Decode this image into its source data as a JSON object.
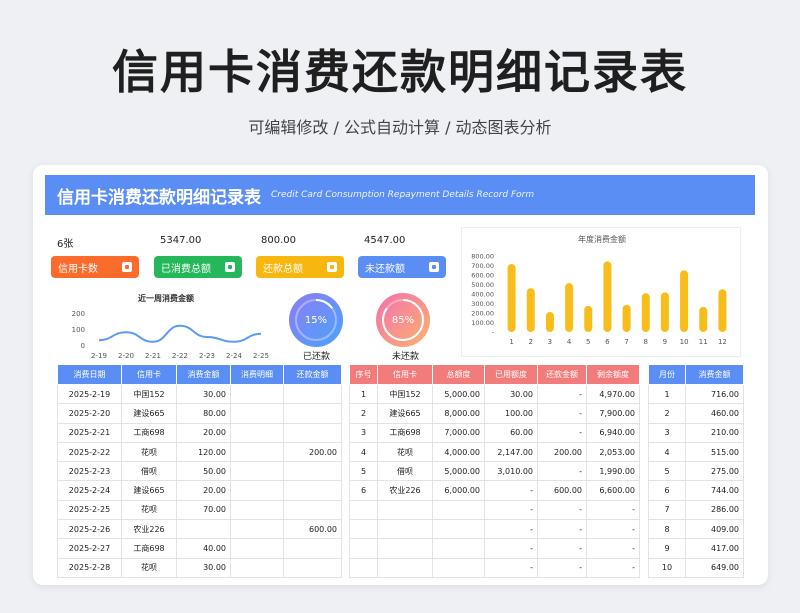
{
  "title": "信用卡消费还款明细记录表",
  "subtitle": "可编辑修改 /  公式自动计算  /  动态图表分析",
  "banner": {
    "cn": "信用卡消费还款明细记录表",
    "en": "Credit Card Consumption Repayment Details Record Form"
  },
  "kpis": [
    {
      "value": "6张",
      "label": "信用卡数",
      "color": "#fb6b2c"
    },
    {
      "value": "5347.00",
      "label": "已消费总额",
      "color": "#25b85a"
    },
    {
      "value": "800.00",
      "label": "还款总额",
      "color": "#f8b70e"
    },
    {
      "value": "4547.00",
      "label": "未还款额",
      "color": "#5b8ef5"
    }
  ],
  "rings": [
    {
      "pct": "15%",
      "caption": "已还款",
      "fraction": 0.15
    },
    {
      "pct": "85%",
      "caption": "未还款",
      "fraction": 0.85
    }
  ],
  "weekly_title": "近一周消费金额",
  "yearly_title": "年度消费金额",
  "chart_data": [
    {
      "type": "line",
      "title": "近一周消费金额",
      "categories": [
        "2-19",
        "2-20",
        "2-21",
        "2-22",
        "2-23",
        "2-24",
        "2-25"
      ],
      "values": [
        30,
        80,
        20,
        120,
        50,
        20,
        70
      ],
      "ylim": [
        0,
        200
      ],
      "yticks": [
        "200",
        "100",
        "0"
      ]
    },
    {
      "type": "bar",
      "title": "年度消费金额",
      "categories": [
        "1",
        "2",
        "3",
        "4",
        "5",
        "6",
        "7",
        "8",
        "9",
        "10",
        "11",
        "12"
      ],
      "values": [
        716,
        460,
        210,
        515,
        275,
        744,
        286,
        409,
        417,
        649,
        265,
        450
      ],
      "ylim": [
        0,
        800
      ],
      "yticks": [
        "800.00",
        "700.00",
        "600.00",
        "500.00",
        "400.00",
        "300.00",
        "200.00",
        "100.00",
        "-"
      ]
    }
  ],
  "consume_table": {
    "headers": [
      "消费日期",
      "信用卡",
      "消费金额",
      "消费明细",
      "还款金额"
    ],
    "rows": [
      [
        "2025-2-19",
        "中国152",
        "30.00",
        "",
        ""
      ],
      [
        "2025-2-20",
        "建设665",
        "80.00",
        "",
        ""
      ],
      [
        "2025-2-21",
        "工商698",
        "20.00",
        "",
        ""
      ],
      [
        "2025-2-22",
        "花呗",
        "120.00",
        "",
        "200.00"
      ],
      [
        "2025-2-23",
        "借呗",
        "50.00",
        "",
        ""
      ],
      [
        "2025-2-24",
        "建设665",
        "20.00",
        "",
        ""
      ],
      [
        "2025-2-25",
        "花呗",
        "70.00",
        "",
        ""
      ],
      [
        "2025-2-26",
        "农业226",
        "",
        "",
        "600.00"
      ],
      [
        "2025-2-27",
        "工商698",
        "40.00",
        "",
        ""
      ],
      [
        "2025-2-28",
        "花呗",
        "30.00",
        "",
        ""
      ]
    ]
  },
  "card_table": {
    "headers": [
      "序号",
      "信用卡",
      "总额度",
      "已用额度",
      "还款金额",
      "剩余额度"
    ],
    "rows": [
      [
        "1",
        "中国152",
        "5,000.00",
        "30.00",
        "-",
        "4,970.00"
      ],
      [
        "2",
        "建设665",
        "8,000.00",
        "100.00",
        "-",
        "7,900.00"
      ],
      [
        "3",
        "工商698",
        "7,000.00",
        "60.00",
        "-",
        "6,940.00"
      ],
      [
        "4",
        "花呗",
        "4,000.00",
        "2,147.00",
        "200.00",
        "2,053.00"
      ],
      [
        "5",
        "借呗",
        "5,000.00",
        "3,010.00",
        "-",
        "1,990.00"
      ],
      [
        "6",
        "农业226",
        "6,000.00",
        "-",
        "600.00",
        "6,600.00"
      ],
      [
        "",
        "",
        "",
        "-",
        "-",
        "-"
      ],
      [
        "",
        "",
        "",
        "-",
        "-",
        "-"
      ],
      [
        "",
        "",
        "",
        "-",
        "-",
        "-"
      ],
      [
        "",
        "",
        "",
        "-",
        "-",
        "-"
      ]
    ]
  },
  "month_table": {
    "headers": [
      "月份",
      "消费金额"
    ],
    "rows": [
      [
        "1",
        "716.00"
      ],
      [
        "2",
        "460.00"
      ],
      [
        "3",
        "210.00"
      ],
      [
        "4",
        "515.00"
      ],
      [
        "5",
        "275.00"
      ],
      [
        "6",
        "744.00"
      ],
      [
        "7",
        "286.00"
      ],
      [
        "8",
        "409.00"
      ],
      [
        "9",
        "417.00"
      ],
      [
        "10",
        "649.00"
      ]
    ]
  }
}
